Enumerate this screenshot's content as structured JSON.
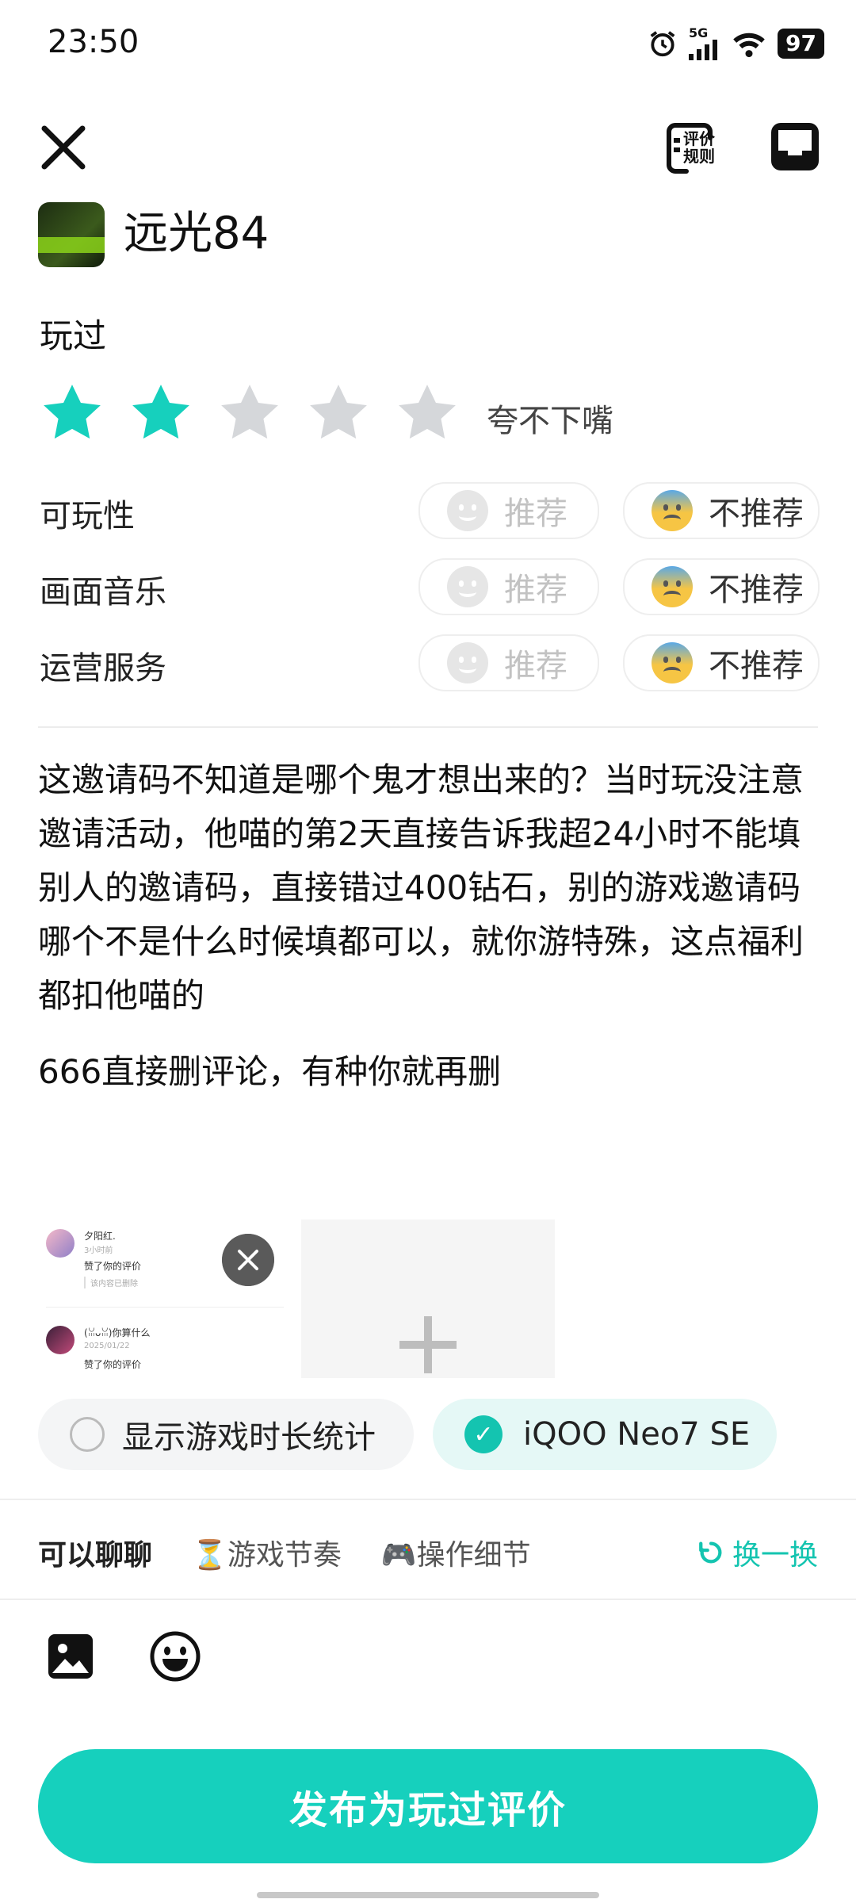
{
  "status_bar": {
    "time": "23:50",
    "network": "5G",
    "battery": "97"
  },
  "header": {
    "close_icon": "close-icon",
    "rules_label": "评价规则",
    "draft_icon": "draft-box-icon"
  },
  "game": {
    "name": "远光84"
  },
  "rating": {
    "label": "玩过",
    "stars_filled": 2,
    "stars_total": 5,
    "text": "夸不下嘴",
    "star_color": "#16d0bd"
  },
  "categories": [
    {
      "label": "可玩性",
      "recommend": "推荐",
      "not_recommend": "不推荐",
      "selected": "not_recommend"
    },
    {
      "label": "画面音乐",
      "recommend": "推荐",
      "not_recommend": "不推荐",
      "selected": "not_recommend"
    },
    {
      "label": "运营服务",
      "recommend": "推荐",
      "not_recommend": "不推荐",
      "selected": "not_recommend"
    }
  ],
  "review": {
    "paragraph1": "这邀请码不知道是哪个鬼才想出来的？当时玩没注意邀请活动，他喵的第2天直接告诉我超24小时不能填别人的邀请码，直接错过400钻石，别的游戏邀请码哪个不是什么时候填都可以，就你游特殊，这点福利都扣他喵的",
    "paragraph2": "666直接删评论，有种你就再删"
  },
  "attachment": {
    "items": [
      {
        "user": "夕阳红.",
        "time": "3小时前",
        "action": "赞了你的评价",
        "note": "该内容已删除"
      },
      {
        "user": "(ꈍᴗꈍ)你算什么",
        "time": "2025/01/22",
        "action": "赞了你的评价"
      }
    ]
  },
  "options": {
    "show_duration": "显示游戏时长统计",
    "show_duration_checked": false,
    "device": "iQOO Neo7 SE",
    "device_checked": true
  },
  "topics": {
    "lead": "可以聊聊",
    "items": [
      "⏳游戏节奏",
      "🎮操作细节"
    ],
    "refresh": "换一换"
  },
  "toolbar": {
    "image_icon": "image-icon",
    "emoji_icon": "emoji-icon"
  },
  "publish_button": "发布为玩过评价",
  "colors": {
    "accent": "#16d0bd",
    "accent_light": "#e5f8f6"
  }
}
